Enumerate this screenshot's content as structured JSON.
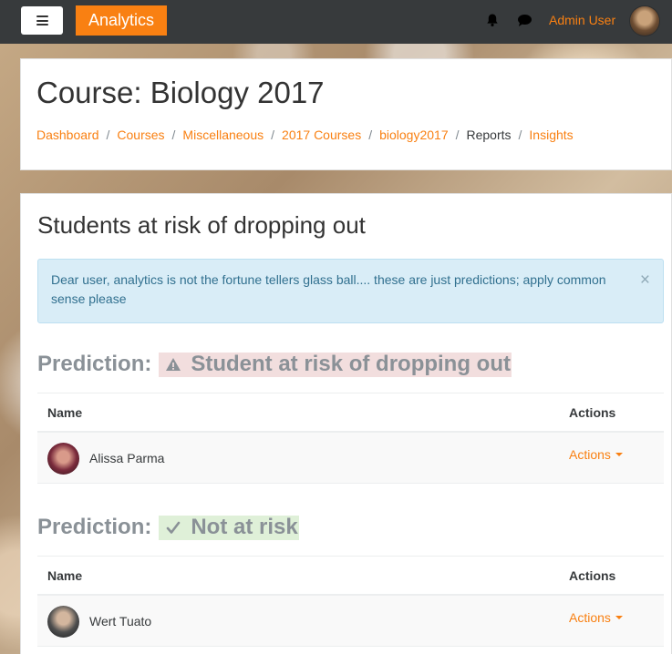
{
  "navbar": {
    "brand": "Analytics",
    "user_name": "Admin User"
  },
  "header": {
    "title": "Course: Biology 2017",
    "breadcrumb": [
      "Dashboard",
      "Courses",
      "Miscellaneous",
      "2017 Courses",
      "biology2017",
      "Reports",
      "Insights"
    ]
  },
  "main": {
    "title": "Students at risk of dropping out",
    "alert_text": "Dear user, analytics is not the fortune tellers glass ball.... these are just predictions; apply common sense please",
    "alert_close": "×",
    "predictions": [
      {
        "label": "Prediction:",
        "value": "Student at risk of dropping out",
        "icon": "warning-icon",
        "table": {
          "headers": [
            "Name",
            "Actions"
          ],
          "rows": [
            {
              "name": "Alissa Parma",
              "actions": "Actions"
            }
          ]
        }
      },
      {
        "label": "Prediction:",
        "value": "Not at risk",
        "icon": "check-icon",
        "table": {
          "headers": [
            "Name",
            "Actions"
          ],
          "rows": [
            {
              "name": "Wert Tuato",
              "actions": "Actions"
            }
          ]
        }
      }
    ]
  },
  "colors": {
    "brand": "#f98012",
    "navbar": "#373a3c",
    "alert_bg": "#d9edf7",
    "risk_bg": "#f2dede",
    "safe_bg": "#dff0d8"
  }
}
